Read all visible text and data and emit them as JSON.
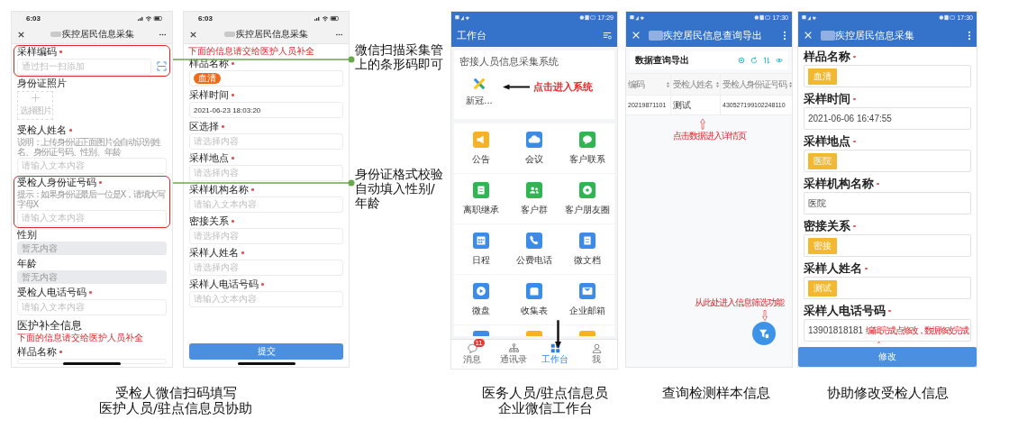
{
  "screens": [
    {
      "kind": "ios_form",
      "status_time": "6:03",
      "title": "疾控居民信息采集",
      "fields": [
        {
          "kind": "scan",
          "label": "采样编码",
          "required": true,
          "placeholder": "通过扫一扫添加",
          "highlighted": true
        },
        {
          "kind": "photo",
          "label": "身份证照片",
          "required": false,
          "button": "选择图片",
          "highlighted": false
        },
        {
          "kind": "input",
          "label": "受检人姓名",
          "required": true,
          "hint": "说明：上传身份证正面图片会自动识别姓名、身份证号码、性别、年龄",
          "placeholder": "请输入文本内容",
          "highlighted": false
        },
        {
          "kind": "input",
          "label": "受检人身份证号码",
          "required": true,
          "hint": "提示：如果身份证最后一位是X，请填大写字母X",
          "placeholder": "请输入文本内容",
          "highlighted": true
        },
        {
          "kind": "readonly",
          "label": "性别",
          "required": false,
          "placeholder": "暂无内容",
          "highlighted": false
        },
        {
          "kind": "readonly",
          "label": "年龄",
          "required": false,
          "placeholder": "暂无内容",
          "highlighted": false
        },
        {
          "kind": "input",
          "label": "受检人电话号码",
          "required": true,
          "placeholder": "请输入文本内容",
          "highlighted": false
        },
        {
          "kind": "section",
          "label": "医护补全信息",
          "note": "下面的信息请交给医护人员补全",
          "highlighted": false
        },
        {
          "kind": "cut",
          "label": "样品名称",
          "required": true,
          "highlighted": false
        }
      ]
    },
    {
      "kind": "ios_form",
      "status_time": "6:03",
      "title": "疾控居民信息采集",
      "note": "下面的信息请交给医护人员补全",
      "fields": [
        {
          "kind": "tag",
          "label": "样品名称",
          "required": true,
          "value": "血清"
        },
        {
          "kind": "input",
          "label": "采样时间",
          "required": true,
          "value": "2021-06-23 18:03:20"
        },
        {
          "kind": "input",
          "label": "区选择",
          "required": true,
          "placeholder": "请选择内容"
        },
        {
          "kind": "input",
          "label": "采样地点",
          "required": true,
          "placeholder": "请选择内容"
        },
        {
          "kind": "input",
          "label": "采样机构名称",
          "required": true,
          "placeholder": "请输入文本内容"
        },
        {
          "kind": "input",
          "label": "密接关系",
          "required": true,
          "placeholder": "请选择内容"
        },
        {
          "kind": "input",
          "label": "采样人姓名",
          "required": true,
          "placeholder": "请选择内容"
        },
        {
          "kind": "input",
          "label": "采样人电话号码",
          "required": true,
          "placeholder": "请输入文本内容"
        }
      ],
      "button": "提交"
    },
    {
      "kind": "workbench",
      "status_time": "17:29",
      "title": "工作台",
      "section_title": "密接人员信息采集系统",
      "app_label": "新冠...",
      "app_annotation": "点击进入系统",
      "apps": [
        {
          "kind": "megaphone",
          "label": "公告",
          "color": "#f5b324"
        },
        {
          "kind": "cloud",
          "label": "会议",
          "color": "#3d8be8"
        },
        {
          "kind": "chat",
          "label": "客户联系",
          "color": "#2fb552"
        },
        {
          "kind": "document",
          "label": "离职继承",
          "color": "#2fb552"
        },
        {
          "kind": "people",
          "label": "客户群",
          "color": "#2fb552"
        },
        {
          "kind": "flower",
          "label": "客户朋友圈",
          "color": "#2fb552"
        },
        {
          "kind": "calendar",
          "label": "日程",
          "color": "#3d8be8"
        },
        {
          "kind": "phone",
          "label": "公费电话",
          "color": "#3d8be8"
        },
        {
          "kind": "document",
          "label": "微文档",
          "color": "#3d8be8"
        },
        {
          "kind": "play",
          "label": "微盘",
          "color": "#3d8be8"
        },
        {
          "kind": "tray",
          "label": "收集表",
          "color": "#3d8be8"
        },
        {
          "kind": "mail",
          "label": "企业邮箱",
          "color": "#3d8be8"
        }
      ],
      "cut_apps": [
        {
          "color": "#3d8be8"
        },
        {
          "color": "#f5b324"
        },
        {
          "color": "#f5b324"
        }
      ],
      "nav": [
        {
          "kind": "chat",
          "label": "消息",
          "badge": "11",
          "selected": false
        },
        {
          "kind": "org",
          "label": "通讯录",
          "selected": false
        },
        {
          "kind": "grid",
          "label": "工作台",
          "selected": true
        },
        {
          "kind": "person",
          "label": "我",
          "selected": false
        }
      ]
    },
    {
      "kind": "query",
      "status_time": "17:30",
      "title": "疾控居民信息查询导出",
      "card_title": "数据查询导出",
      "columns": [
        "编码",
        "受检人姓名",
        "受检人身份证号码"
      ],
      "rows": [
        [
          "20219871101",
          "测试",
          "430527199102248110"
        ]
      ],
      "annotation_top": "点击数据进入详情页",
      "annotation_bottom": "从此处进入信息筛选功能"
    },
    {
      "kind": "android_form",
      "status_time": "17:30",
      "title": "疾控居民信息采集",
      "fields": [
        {
          "kind": "tag",
          "label": "样品名称",
          "required": true,
          "value": "血清"
        },
        {
          "kind": "input",
          "label": "采样时间",
          "required": true,
          "value": "2021-06-06 16:47:55"
        },
        {
          "kind": "tag",
          "label": "采样地点",
          "required": true,
          "value": "医院"
        },
        {
          "kind": "input",
          "label": "采样机构名称",
          "required": true,
          "value": "医院"
        },
        {
          "kind": "tag",
          "label": "密接关系",
          "required": true,
          "value": "密接"
        },
        {
          "kind": "tag",
          "label": "采样人姓名",
          "required": true,
          "value": "测试"
        },
        {
          "kind": "input",
          "label": "采样人电话号码",
          "required": true,
          "value": "13901818181",
          "note": "编辑完成点修改，数据修改完成"
        }
      ],
      "button": "修改"
    }
  ],
  "callouts": [
    "微信扫描采集管上的条形码即可",
    "身份证格式校验自动填入性别/年龄"
  ],
  "captions": [
    {
      "lines": [
        "受检人微信扫码填写",
        "医护人员/驻点信息员协助"
      ]
    },
    {
      "lines": [
        "医务人员/驻点信息员",
        "企业微信工作台"
      ]
    },
    {
      "lines": [
        "查询检测样本信息"
      ]
    },
    {
      "lines": [
        "协助修改受检人信息"
      ]
    }
  ]
}
